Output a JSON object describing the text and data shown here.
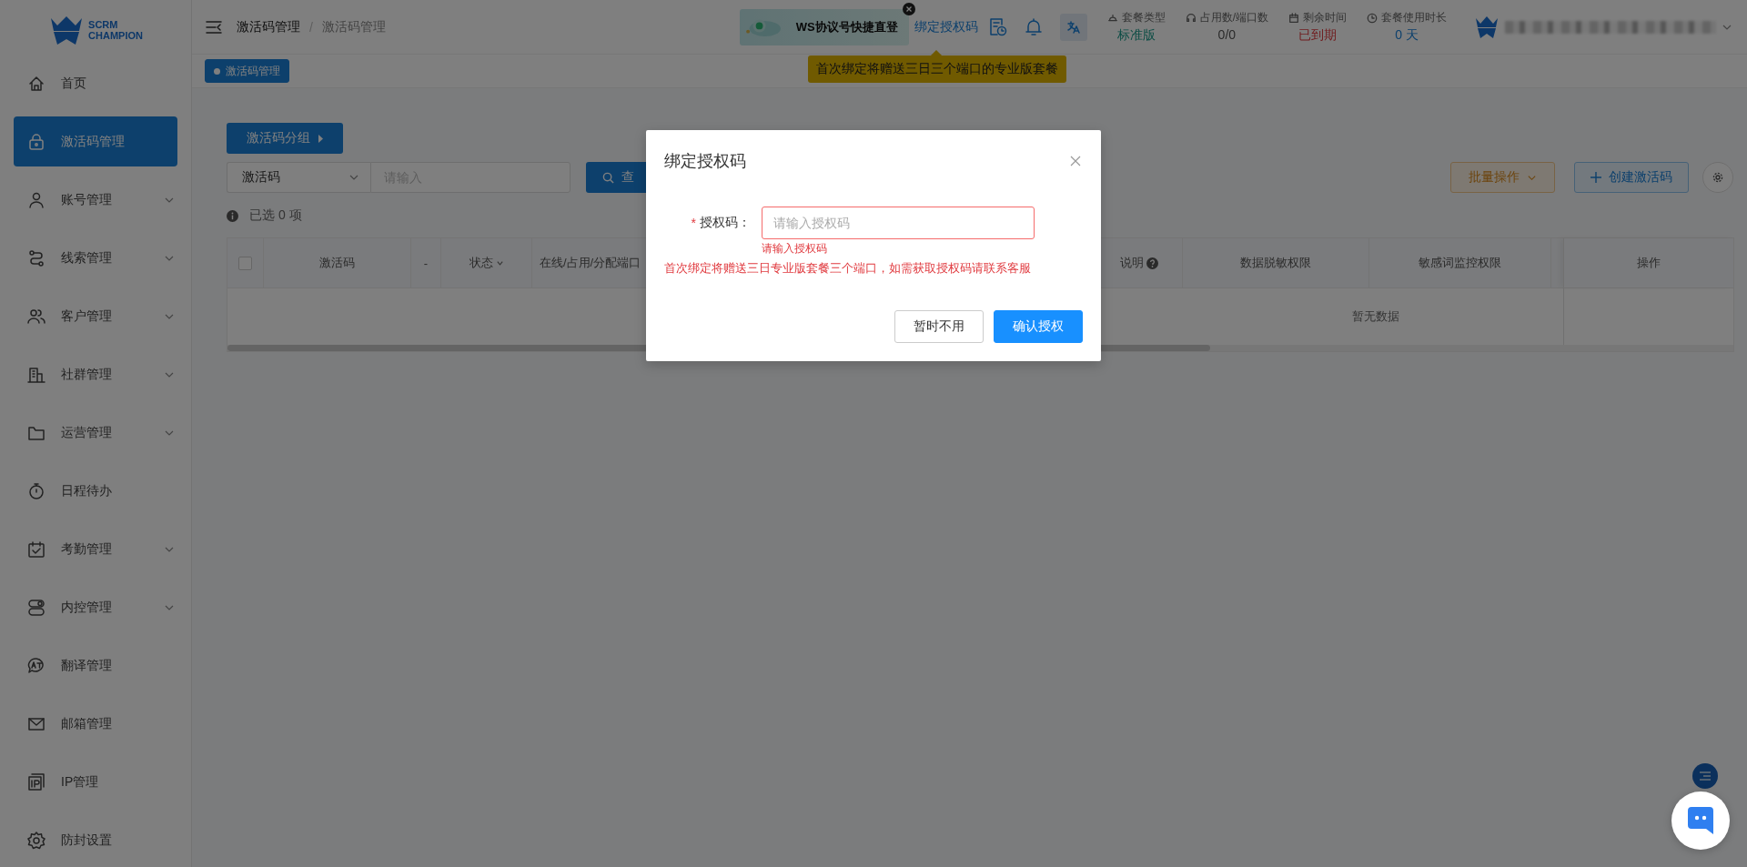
{
  "logo": {
    "line1": "SCRM",
    "line2": "CHAMPION"
  },
  "sidebar": {
    "items": [
      {
        "label": "首页",
        "expandable": false,
        "selected": false
      },
      {
        "label": "激活码管理",
        "expandable": false,
        "selected": true
      },
      {
        "label": "账号管理",
        "expandable": true,
        "selected": false
      },
      {
        "label": "线索管理",
        "expandable": true,
        "selected": false
      },
      {
        "label": "客户管理",
        "expandable": true,
        "selected": false
      },
      {
        "label": "社群管理",
        "expandable": true,
        "selected": false
      },
      {
        "label": "运营管理",
        "expandable": true,
        "selected": false
      },
      {
        "label": "日程待办",
        "expandable": false,
        "selected": false
      },
      {
        "label": "考勤管理",
        "expandable": true,
        "selected": false
      },
      {
        "label": "内控管理",
        "expandable": true,
        "selected": false
      },
      {
        "label": "翻译管理",
        "expandable": false,
        "selected": false
      },
      {
        "label": "邮箱管理",
        "expandable": false,
        "selected": false
      },
      {
        "label": "IP管理",
        "expandable": false,
        "selected": false
      },
      {
        "label": "防封设置",
        "expandable": false,
        "selected": false
      }
    ]
  },
  "header": {
    "breadcrumb": [
      "激活码管理",
      "激活码管理"
    ],
    "breadcrumb_separator": "/",
    "promo": {
      "text": "WS协议号快捷直登"
    },
    "bind_link": "绑定授权码",
    "tooltip": "首次绑定将赠送三日三个端口的专业版套餐",
    "stats": [
      {
        "label": "套餐类型",
        "value": "标准版",
        "kind": "plan"
      },
      {
        "label": "占用数/端口数",
        "value": "0/0",
        "kind": "count"
      },
      {
        "label": "剩余时间",
        "value": "已到期",
        "kind": "expired"
      },
      {
        "label": "套餐使用时长",
        "value": "0 天",
        "kind": "duration"
      }
    ]
  },
  "tags": [
    {
      "label": "激活码管理",
      "selected": true
    }
  ],
  "toolbar": {
    "group_button": "激活码分组",
    "filter_select": "激活码",
    "filter_placeholder": "请输入",
    "search_button": "查",
    "batch_button": "批量操作",
    "create_button": "创建激活码"
  },
  "selection": "已选 0 项",
  "table": {
    "columns": [
      {
        "kind": "checkbox",
        "checked": false
      },
      {
        "kind": "text",
        "label": "激活码"
      },
      {
        "kind": "text",
        "label": "-"
      },
      {
        "kind": "sort",
        "label": "状态"
      },
      {
        "kind": "text",
        "label": "在线/占用/分配端口"
      },
      {
        "kind": "help",
        "label": "说明"
      },
      {
        "kind": "text",
        "label": "数据脱敏权限"
      },
      {
        "kind": "text",
        "label": "敏感词监控权限"
      },
      {
        "kind": "text",
        "label": "操作"
      }
    ],
    "empty_text": "暂无数据"
  },
  "modal": {
    "title": "绑定授权码",
    "field": {
      "label": "授权码：",
      "required_mark": "*",
      "placeholder": "请输入授权码",
      "error": "请输入授权码"
    },
    "note": "首次绑定将赠送三日专业版套餐三个端口，如需获取授权码请联系客服",
    "buttons": [
      {
        "label": "暂时不用",
        "kind": "default"
      },
      {
        "label": "确认授权",
        "kind": "primary"
      }
    ]
  }
}
